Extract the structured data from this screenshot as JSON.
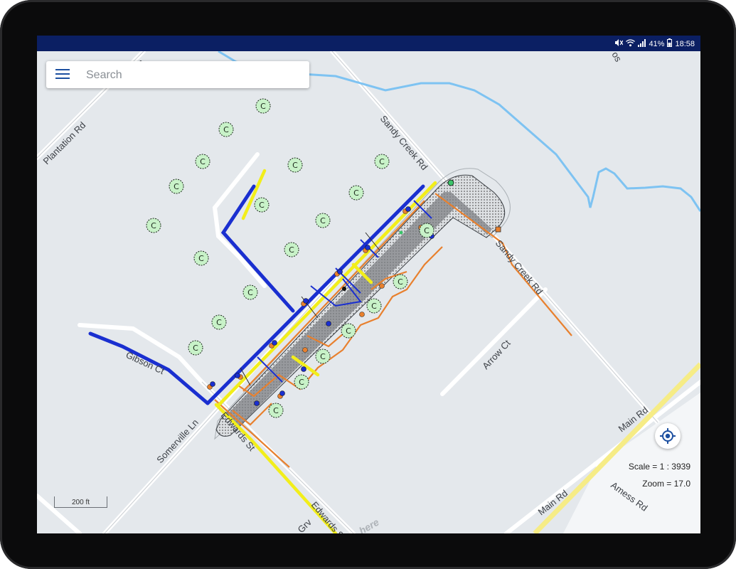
{
  "status_bar": {
    "battery": "41%",
    "time": "18:58"
  },
  "search": {
    "placeholder": "Search"
  },
  "streets": {
    "plantation_rd": "Plantation Rd",
    "plantation_top": "Plan",
    "sandy_creek_rd_1": "Sandy Creek Rd",
    "sandy_creek_rd_2": "Sandy Creek Rd",
    "gibson_ct": "Gibson Ct",
    "somerville_ln": "Somerville Ln",
    "edwards_st_1": "Edwards St",
    "edwards_st_2": "Edwards St",
    "arrow_ct": "Arrow Ct",
    "main_rd_1": "Main Rd",
    "main_rd_2": "Main Rd",
    "amess_rd": "Amess Rd",
    "grv": "Grv",
    "top_right_fragment": "os"
  },
  "map_info": {
    "scale": "Scale = 1 : 3939",
    "zoom": "Zoom = 17.0",
    "scale_bar": "200  ft",
    "watermark": "here"
  },
  "markers": {
    "customer_symbol": "C"
  },
  "colors": {
    "status_bar": "#0b1f63",
    "map_background": "#e4e8ec",
    "water": "#7ec3f2",
    "main_line": "#1a2fd0",
    "secondary_line": "#f2ee1a",
    "service_line": "#e8802e",
    "marker_fill": "#c8f2c8",
    "icon_blue": "#1c4fa0"
  },
  "icons": {
    "menu": "hamburger-menu-icon",
    "locate": "gps-locate-icon",
    "mute": "mute-icon",
    "wifi": "wifi-icon",
    "signal": "signal-icon",
    "battery": "battery-icon"
  }
}
